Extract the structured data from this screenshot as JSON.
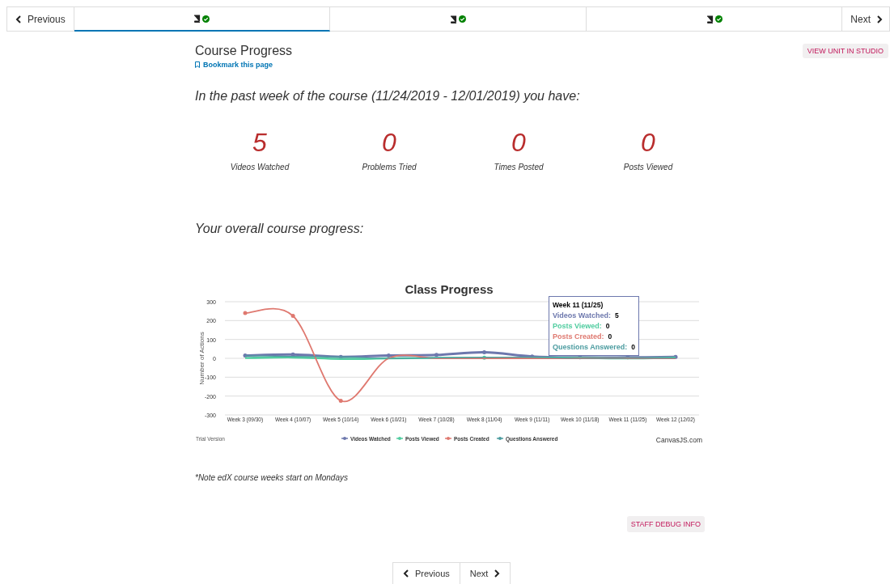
{
  "top_nav": {
    "previous": "Previous",
    "next": "Next",
    "tabs": [
      {
        "selected": true,
        "complete": true
      },
      {
        "selected": false,
        "complete": true
      },
      {
        "selected": false,
        "complete": true
      }
    ]
  },
  "studio_button": "VIEW UNIT IN STUDIO",
  "title": "Course Progress",
  "bookmark": "Bookmark this page",
  "week_summary": "In the past week of the course (11/24/2019 - 12/01/2019) you have:",
  "stats": [
    {
      "value": "5",
      "label": "Videos Watched"
    },
    {
      "value": "0",
      "label": "Problems Tried"
    },
    {
      "value": "0",
      "label": "Times Posted"
    },
    {
      "value": "0",
      "label": "Posts Viewed"
    }
  ],
  "overall_heading": "Your overall course progress:",
  "chart": {
    "chart_data": {
      "type": "line",
      "title": "Class Progress",
      "ylabel": "Number of Actions",
      "categories": [
        "Week 3 (09/30)",
        "Week 4 (10/07)",
        "Week 5 (10/14)",
        "Week 6 (10/21)",
        "Week 7 (10/28)",
        "Week 8 (11/04)",
        "Week 9 (11/11)",
        "Week 10 (11/18)",
        "Week 11 (11/25)",
        "Week 12 (12/02)"
      ],
      "series": [
        {
          "name": "Videos Watched",
          "color": "#6d78ad",
          "values": [
            15,
            20,
            8,
            15,
            18,
            32,
            10,
            5,
            5,
            8
          ]
        },
        {
          "name": "Posts Viewed",
          "color": "#51cda0",
          "values": [
            2,
            5,
            -3,
            0,
            2,
            3,
            3,
            2,
            0,
            3
          ]
        },
        {
          "name": "Posts Created",
          "color": "#df7970",
          "values": [
            240,
            225,
            -225,
            0,
            0,
            0,
            0,
            0,
            0,
            0
          ]
        },
        {
          "name": "Questions Answered",
          "color": "#4c9ca0",
          "values": [
            15,
            10,
            8,
            0,
            3,
            5,
            5,
            0,
            0,
            2
          ]
        }
      ],
      "grid": true,
      "legend": true,
      "ylim": [
        -300,
        300
      ],
      "yticks": [
        -300,
        -200,
        -100,
        0,
        100,
        200,
        300
      ]
    },
    "tooltip": {
      "title": "Week 11 (11/25)",
      "rows": [
        {
          "label": "Videos Watched:",
          "value": "5",
          "color": "#6d78ad"
        },
        {
          "label": "Posts Viewed:",
          "value": "0",
          "color": "#51cda0"
        },
        {
          "label": "Posts Created:",
          "value": "0",
          "color": "#df7970"
        },
        {
          "label": "Questions Answered:",
          "value": "0",
          "color": "#4c9ca0"
        }
      ]
    },
    "trial_text": "Trial Version",
    "credit": "CanvasJS.com"
  },
  "note": "*Note edX course weeks start on Mondays",
  "debug_button": "STAFF DEBUG INFO",
  "bottom_nav": {
    "previous": "Previous",
    "next": "Next"
  }
}
